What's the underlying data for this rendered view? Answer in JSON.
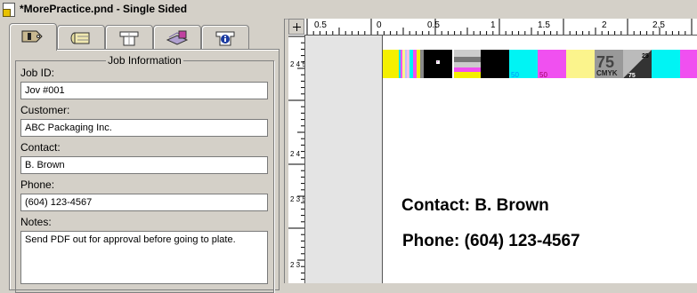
{
  "window": {
    "title": "*MorePractice.pnd - Single Sided"
  },
  "tabs": [
    {
      "name": "job-info",
      "icon": "info-tag-icon"
    },
    {
      "name": "materials",
      "icon": "roll-icon"
    },
    {
      "name": "box",
      "icon": "box-icon"
    },
    {
      "name": "stack",
      "icon": "stack-icon"
    },
    {
      "name": "box-info",
      "icon": "box-info-icon"
    }
  ],
  "job_info": {
    "group_title": "Job Information",
    "job_id_label": "Job ID:",
    "job_id_value": "Jov #001",
    "customer_label": "Customer:",
    "customer_value": "ABC Packaging Inc.",
    "contact_label": "Contact:",
    "contact_value": "B. Brown",
    "phone_label": "Phone:",
    "phone_value": "(604) 123-4567",
    "notes_label": "Notes:",
    "notes_value": "Send PDF out for approval before going to plate."
  },
  "ruler": {
    "h_labels": [
      "0.5",
      "0",
      "0.5",
      "1",
      "1.5",
      "2",
      "2.5"
    ],
    "v_labels": [
      "2 4 5",
      "2 4",
      "2 3 5",
      "2 3"
    ]
  },
  "colorbar": {
    "labels": [
      "50",
      "50",
      "75",
      "CMYK",
      "25",
      "75"
    ],
    "colors": {
      "yellow": "#f4f000",
      "cyan": "#00f4f4",
      "magenta": "#f050f0",
      "black": "#000000",
      "light_yellow": "#fbf48c",
      "gray": "#999999"
    }
  },
  "page": {
    "contact_line": "Contact: B. Brown",
    "phone_line": "Phone: (604) 123-4567"
  }
}
